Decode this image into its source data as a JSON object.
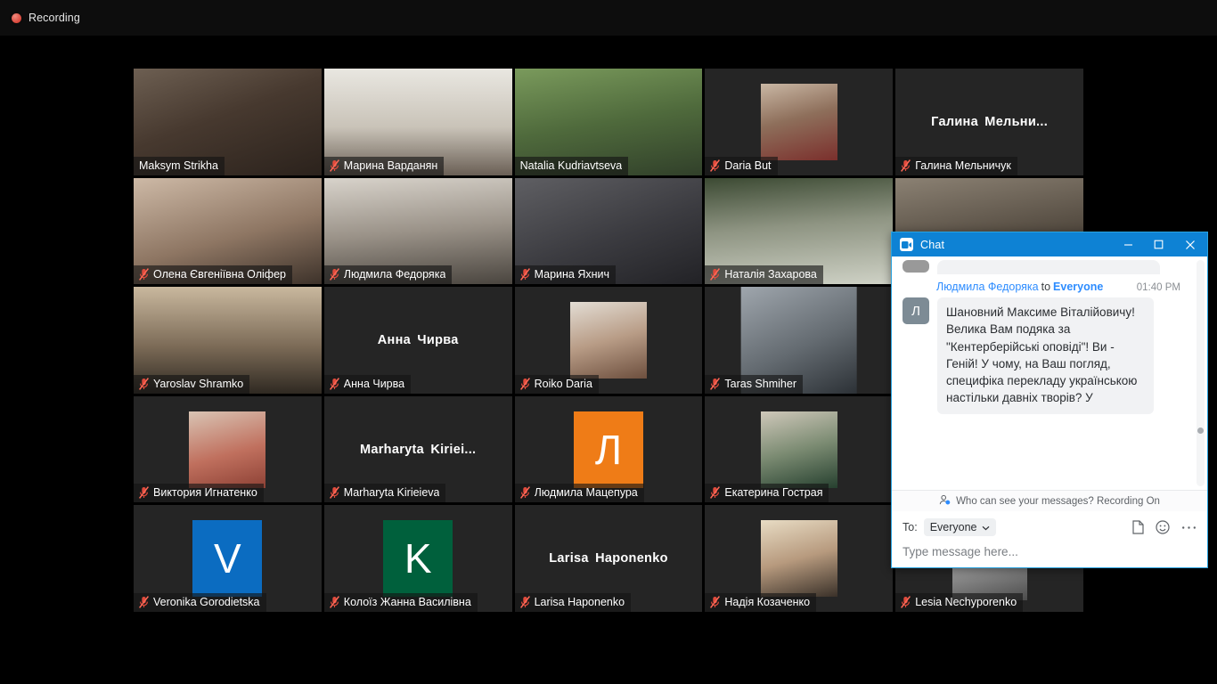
{
  "recording": {
    "label": "Recording",
    "dot_color": "#d9463a"
  },
  "theme": {
    "active_speaker_border": "#c7e461",
    "tile_bg": "#252525",
    "chat_accent": "#0e82d4",
    "link_blue": "#2d8cff"
  },
  "gallery": {
    "columns": 5,
    "rows": 5,
    "participants": [
      {
        "name": "Maksym Strikha",
        "kind": "video",
        "muted": false,
        "active": false
      },
      {
        "name": "Марина Варданян",
        "kind": "video",
        "muted": true,
        "active": false
      },
      {
        "name": "Natalia Kudriavtseva",
        "kind": "video",
        "muted": false,
        "active": true
      },
      {
        "name": "Daria But",
        "kind": "photo",
        "muted": true,
        "active": false
      },
      {
        "name": "Галина Мельничук",
        "kind": "name",
        "display_name": "Галина  Мельни...",
        "muted": true,
        "active": false
      },
      {
        "name": "Олена Євгеніївна Оліфер",
        "kind": "video",
        "muted": true,
        "active": false
      },
      {
        "name": "Людмила Федоряка",
        "kind": "video",
        "muted": true,
        "active": false
      },
      {
        "name": "Марина Яхнич",
        "kind": "video",
        "muted": true,
        "active": false
      },
      {
        "name": "Наталія Захарова",
        "kind": "video",
        "muted": true,
        "active": false
      },
      {
        "name": "",
        "kind": "video",
        "muted": false,
        "active": false
      },
      {
        "name": "Yaroslav Shramko",
        "kind": "video",
        "muted": true,
        "active": false
      },
      {
        "name": "Анна Чирва",
        "kind": "name",
        "display_name": "Анна Чирва",
        "muted": true,
        "active": false
      },
      {
        "name": "Roiko Daria",
        "kind": "photo",
        "muted": true,
        "active": false
      },
      {
        "name": "Taras Shmiher",
        "kind": "video",
        "muted": true,
        "active": false
      },
      {
        "name": "",
        "kind": "blank",
        "muted": false,
        "active": false
      },
      {
        "name": "Виктория Игнатенко",
        "kind": "photo",
        "muted": true,
        "active": false
      },
      {
        "name": "Marharyta Kirieieva",
        "kind": "name",
        "display_name": "Marharyta  Kiriei...",
        "muted": true,
        "active": false
      },
      {
        "name": "Людмила Мацепура",
        "kind": "letter",
        "letter": "Л",
        "letter_bg": "#ef7c17",
        "muted": true,
        "active": false
      },
      {
        "name": "Екатерина Гострая",
        "kind": "photo",
        "muted": true,
        "active": false
      },
      {
        "name": "",
        "kind": "blank",
        "muted": false,
        "active": false
      },
      {
        "name": "Veronika Gorodietska",
        "kind": "letter",
        "letter": "V",
        "letter_bg": "#0b6cc1",
        "muted": true,
        "active": false
      },
      {
        "name": "Колоїз Жанна Василівна",
        "kind": "letter",
        "letter": "K",
        "letter_bg": "#00603c",
        "muted": true,
        "active": false
      },
      {
        "name": "Larisa Haponenko",
        "kind": "name",
        "display_name": "Larisa Haponenko",
        "muted": true,
        "active": false
      },
      {
        "name": "Надія Козаченко",
        "kind": "photo",
        "muted": true,
        "active": false
      },
      {
        "name": "Lesia Nechyporenko",
        "kind": "photo",
        "muted": true,
        "active": false
      }
    ]
  },
  "chat": {
    "title": "Chat",
    "window_controls": {
      "minimize": "–",
      "maximize": "☐",
      "close": "✕"
    },
    "messages": [
      {
        "sender": "Людмила Федоряка",
        "to_label": "to",
        "recipient": "Everyone",
        "time": "01:40 PM",
        "avatar_initial": "Л",
        "text": "Шановний Максиме Віталійовичу! Велика Вам подяка за \"Кентерберійські оповіді\"! Ви - Геній! У чому, на Ваш погляд, специфіка перекладу  українською настільки давніх творів? У"
      }
    ],
    "privacy_notice": "Who can see your messages? Recording On",
    "compose": {
      "to_label": "To:",
      "recipient": "Everyone",
      "placeholder": "Type message here...",
      "icons": [
        "file-icon",
        "emoji-icon",
        "more-options-icon"
      ]
    }
  }
}
